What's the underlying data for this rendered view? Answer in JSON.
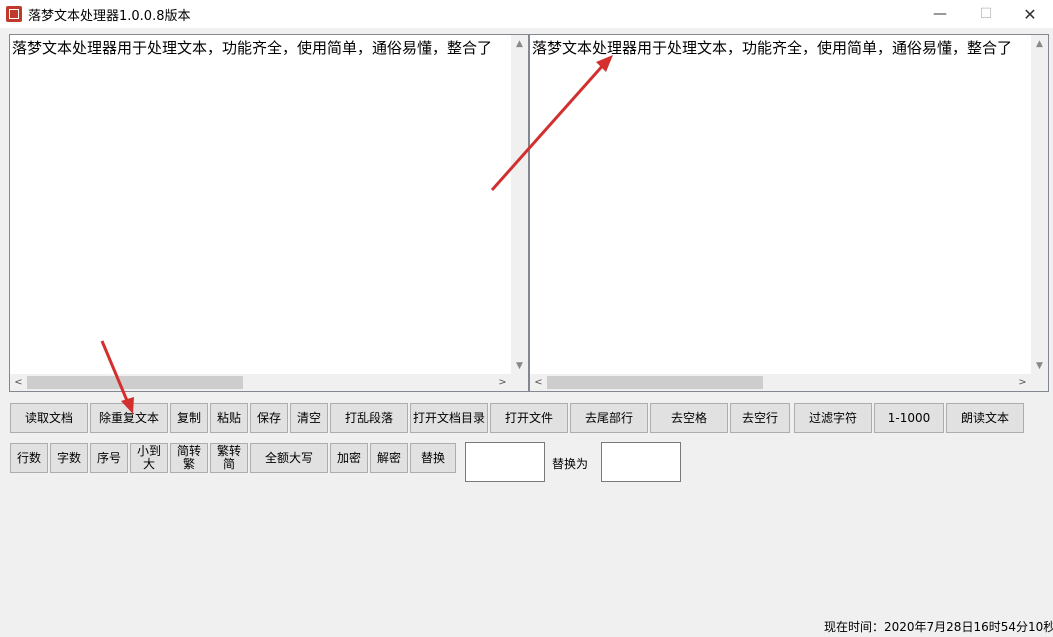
{
  "window": {
    "title": "落梦文本处理器1.0.0.8版本",
    "minimize": "—",
    "maximize": "☐",
    "close": "✕"
  },
  "left_pane": {
    "text": "落梦文本处理器用于处理文本，功能齐全，使用简单，通俗易懂，整合了"
  },
  "right_pane": {
    "text": "落梦文本处理器用于处理文本，功能齐全，使用简单，通俗易懂，整合了"
  },
  "toolbar_row1": [
    "读取文档",
    "除重复文本",
    "复制",
    "粘贴",
    "保存",
    "清空",
    "打乱段落",
    "打开文档目录",
    "打开文件",
    "去尾部行",
    "去空格",
    "去空行",
    "过滤字符",
    "1-1000",
    "朗读文本"
  ],
  "toolbar_row2": [
    "行数",
    "字数",
    "序号",
    "小到\n大",
    "简转\n繁",
    "繁转\n简",
    "全额大写",
    "加密",
    "解密",
    "替换"
  ],
  "replace_label": "替换为",
  "status_time": "现在时间：2020年7月28日16时54分10秒",
  "colors": {
    "arrow": "#d32f2f"
  }
}
